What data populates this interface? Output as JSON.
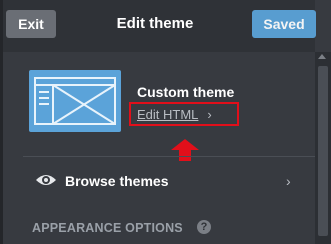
{
  "header": {
    "exit_label": "Exit",
    "title": "Edit theme",
    "saved_label": "Saved"
  },
  "theme": {
    "name": "Custom theme",
    "edit_link": "Edit HTML",
    "edit_chevron": "›"
  },
  "browse": {
    "label": "Browse themes",
    "chevron": "›"
  },
  "appearance": {
    "title": "APPEARANCE OPTIONS",
    "help_glyph": "?"
  },
  "icons": {
    "theme_thumbnail": "layout-template-icon",
    "eye": "eye-icon",
    "help": "help-icon",
    "arrow": "up-arrow-icon"
  },
  "colors": {
    "accent_blue": "#5ba3d9",
    "highlight_red": "#e10f1a",
    "panel_bg": "#373a40",
    "header_bg": "#2f3237"
  }
}
